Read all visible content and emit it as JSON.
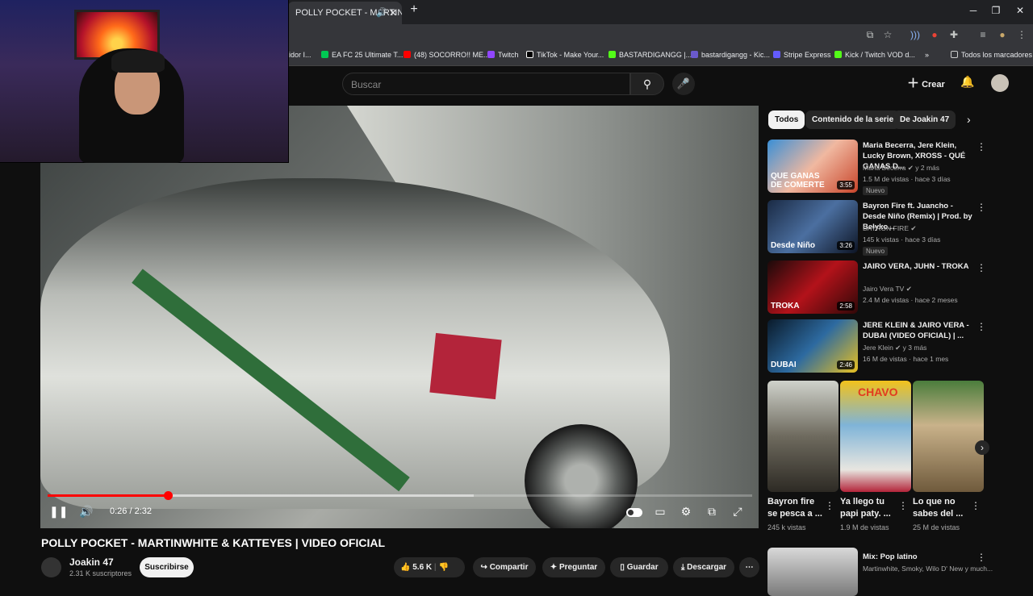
{
  "browser": {
    "tab_title": "POLLY POCKET - MARTINW",
    "bookmarks": [
      "idor I...",
      "EA FC 25 Ultimate T...",
      "(48) SOCORRO!! ME...",
      "Twitch",
      "TikTok - Make Your...",
      "BASTARDIGANGG |...",
      "bastardigangg - Kic...",
      "Stripe Express",
      "Kick / Twitch VOD d..."
    ],
    "all_bookmarks": "Todos los marcadores",
    "colors": {
      "twitch": "#9146ff",
      "kick": "#53fc18",
      "youtube": "#ff0000",
      "stripe": "#635bff",
      "ea": "#00c853"
    }
  },
  "header": {
    "search_placeholder": "Buscar",
    "create_label": "Crear"
  },
  "player": {
    "current_time": "0:26 / 2:32",
    "played_fraction": 0.171,
    "buffered_fraction": 0.605
  },
  "video": {
    "title": "POLLY POCKET - MARTINWHITE & KATTEYES | VIDEO OFICIAL",
    "channel": "Joakin 47",
    "subscribers": "2.31 K suscriptores",
    "subscribe_label": "Suscribirse",
    "likes": "5.6 K",
    "share_label": "Compartir",
    "ask_label": "Preguntar",
    "save_label": "Guardar",
    "download_label": "Descargar"
  },
  "chips": [
    "Todos",
    "Contenido de la serie",
    "De Joakin 47"
  ],
  "related": [
    {
      "title": "Maria Becerra, Jere Klein, Lucky Brown, XROSS - QUÉ GANAS D...",
      "channel": "Maria Becerra",
      "extra": "y 2 más",
      "meta": "1.5 M de vistas · hace 3 días",
      "badge": "Nuevo",
      "duration": "3:55",
      "overlay": "QUE GANAS DE COMERTE"
    },
    {
      "title": "Bayron Fire ft. Juancho - Desde Niño (Remix) | Prod. by Belyko...",
      "channel": "BAYRON FIRE",
      "extra": "",
      "meta": "145 k vistas · hace 3 días",
      "badge": "Nuevo",
      "duration": "3:26",
      "overlay": "Desde Niño"
    },
    {
      "title": "JAIRO VERA, JUHN - TROKA",
      "channel": "Jairo Vera TV",
      "extra": "",
      "meta": "2.4 M de vistas · hace 2 meses",
      "badge": "",
      "duration": "2:58",
      "overlay": "TROKA"
    },
    {
      "title": "JERE KLEIN & JAIRO VERA - DUBAI (VIDEO OFICIAL) | ...",
      "channel": "Jere Klein",
      "extra": "y 3 más",
      "meta": "16 M de vistas · hace 1 mes",
      "badge": "",
      "duration": "2:46",
      "overlay": "DUBAI"
    }
  ],
  "shorts": [
    {
      "title": "Bayron fire se pesca a ...",
      "views": "245 k vistas"
    },
    {
      "title": "Ya llego tu papi paty. ...",
      "views": "1.9 M de vistas"
    },
    {
      "title": "Lo que no sabes del ...",
      "views": "25 M de vistas"
    }
  ],
  "mix": {
    "title": "Mix: Pop latino",
    "meta": "Martinwhite, Smoky, Wilo D' New y much..."
  }
}
